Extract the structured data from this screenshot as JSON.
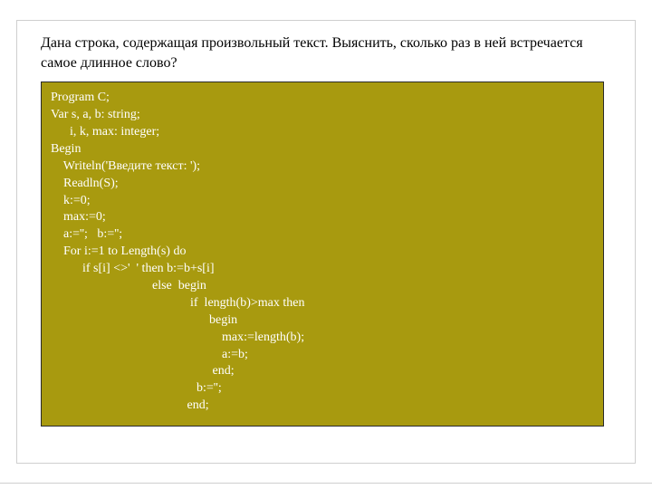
{
  "prompt": "Дана строка, содержащая произвольный текст. Выяснить, сколько раз в ней встречается  самое длинное слово?",
  "code": {
    "l01": "Program C;",
    "l02": "Var s, a, b: string;",
    "l03": "      i, k, max: integer;",
    "l04": "Begin",
    "l05": "    Writeln('Введите текст: ');",
    "l06": "    Readln(S);",
    "l07": "    k:=0;",
    "l08": "    max:=0;",
    "l09": "    a:='';   b:='';",
    "l10": "    For i:=1 to Length(s) do",
    "l11": "          if s[i] <>'  ' then b:=b+s[i]",
    "l12": "                                else  begin",
    "l13": "                                            if  length(b)>max then",
    "l14": "                                                  begin",
    "l15": "                                                      max:=length(b);",
    "l16": "                                                      a:=b;",
    "l17": "                                                   end;",
    "l18": "                                              b:='';",
    "l19": "                                           end;"
  }
}
